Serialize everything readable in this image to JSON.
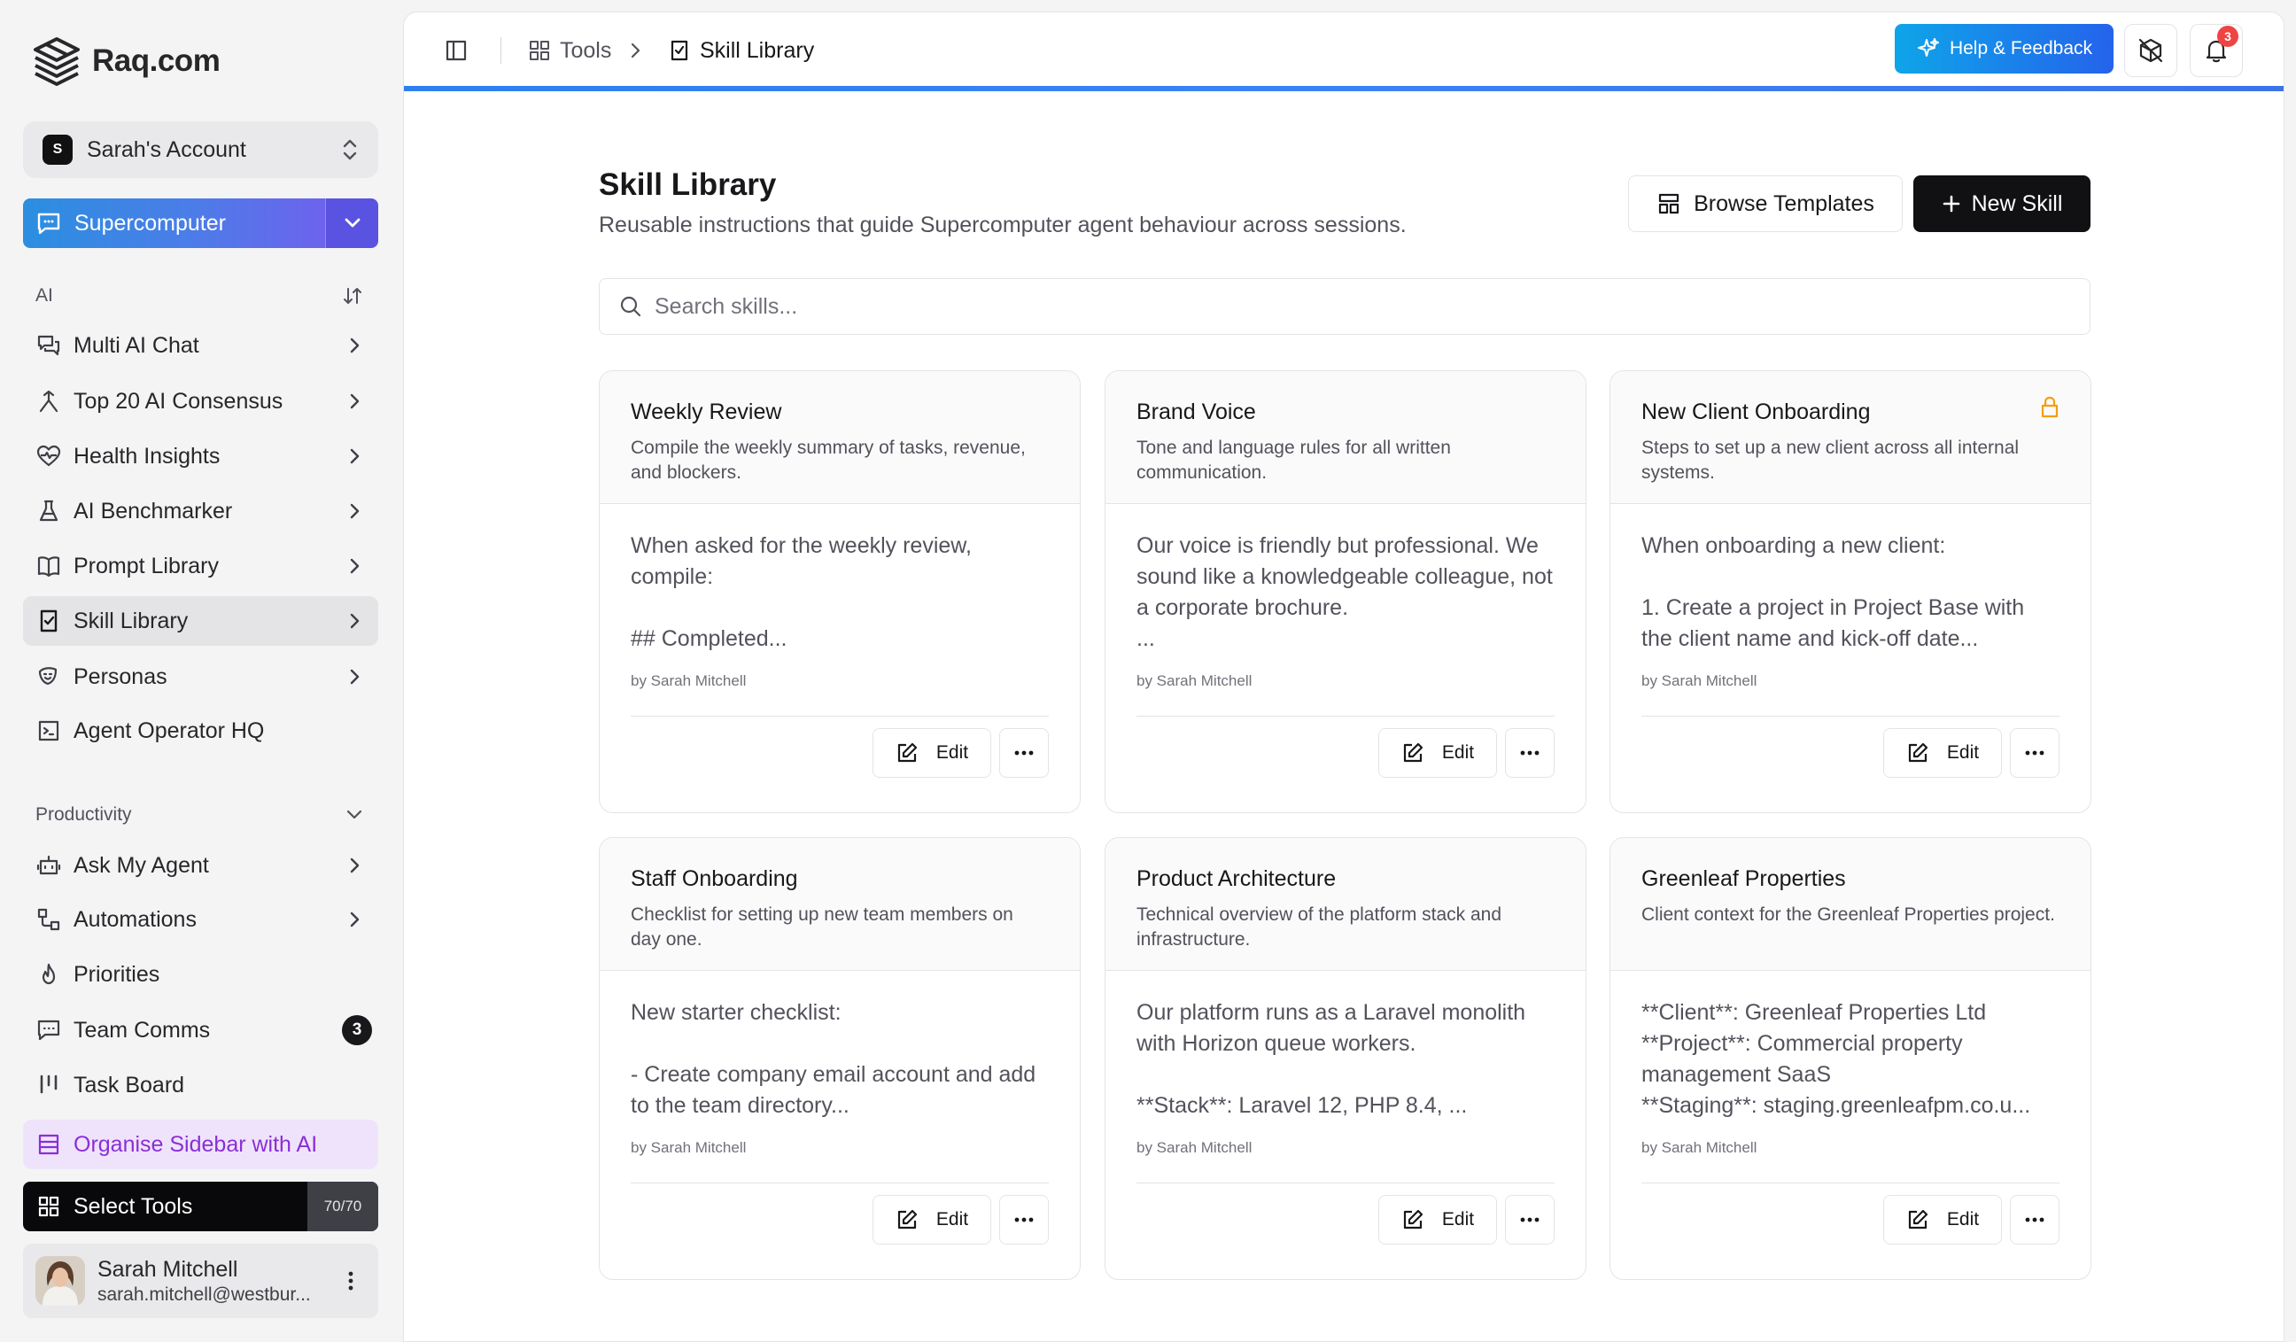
{
  "brand": {
    "name": "Raq.com"
  },
  "account": {
    "badge": "S",
    "name": "Sarah's Account"
  },
  "supercomputer": {
    "label": "Supercomputer"
  },
  "sections": {
    "ai": "AI",
    "productivity": "Productivity"
  },
  "ai_items": [
    {
      "label": "Multi AI Chat",
      "icon": "chat-icon"
    },
    {
      "label": "Top 20 AI Consensus",
      "icon": "consensus-icon"
    },
    {
      "label": "Health Insights",
      "icon": "heart-pulse-icon"
    },
    {
      "label": "AI Benchmarker",
      "icon": "flask-icon"
    },
    {
      "label": "Prompt Library",
      "icon": "book-icon"
    },
    {
      "label": "Skill Library",
      "icon": "skill-icon"
    },
    {
      "label": "Personas",
      "icon": "persona-icon"
    },
    {
      "label": "Agent Operator HQ",
      "icon": "terminal-icon"
    }
  ],
  "productivity_items": [
    {
      "label": "Ask My Agent",
      "icon": "bot-icon"
    },
    {
      "label": "Automations",
      "icon": "workflow-icon"
    },
    {
      "label": "Priorities",
      "icon": "flame-icon"
    },
    {
      "label": "Team Comms",
      "icon": "message-icon",
      "count": "3"
    },
    {
      "label": "Task Board",
      "icon": "kanban-icon"
    }
  ],
  "organise": {
    "label": "Organise Sidebar with AI"
  },
  "select_tools": {
    "label": "Select Tools",
    "count": "70/70"
  },
  "user": {
    "name": "Sarah Mitchell",
    "email": "sarah.mitchell@westbur..."
  },
  "breadcrumb": {
    "tools": "Tools",
    "current": "Skill Library"
  },
  "header": {
    "help": "Help & Feedback",
    "notifications": "3"
  },
  "page": {
    "title": "Skill Library",
    "subtitle": "Reusable instructions that guide Supercomputer agent behaviour across sessions.",
    "browse": "Browse Templates",
    "new": "New Skill",
    "search_placeholder": "Search skills..."
  },
  "cards": [
    {
      "title": "Weekly Review",
      "desc": "Compile the weekly summary of tasks, revenue, and blockers.",
      "content": "When asked for the weekly review, compile:\n\n## Completed...",
      "author": "by Sarah Mitchell",
      "edit": "Edit",
      "locked": false
    },
    {
      "title": "Brand Voice",
      "desc": "Tone and language rules for all written communication.",
      "content": "Our voice is friendly but professional. We sound like a knowledgeable colleague, not a corporate brochure.\n...",
      "author": "by Sarah Mitchell",
      "edit": "Edit",
      "locked": false
    },
    {
      "title": "New Client Onboarding",
      "desc": "Steps to set up a new client across all internal systems.",
      "content": "When onboarding a new client:\n\n1. Create a project in Project Base with the client name and kick-off date...",
      "author": "by Sarah Mitchell",
      "edit": "Edit",
      "locked": true
    },
    {
      "title": "Staff Onboarding",
      "desc": "Checklist for setting up new team members on day one.",
      "content": "New starter checklist:\n\n- Create company email account and add to the team directory...",
      "author": "by Sarah Mitchell",
      "edit": "Edit",
      "locked": false
    },
    {
      "title": "Product Architecture",
      "desc": "Technical overview of the platform stack and infrastructure.",
      "content": "Our platform runs as a Laravel monolith with Horizon queue workers.\n\n**Stack**: Laravel 12, PHP 8.4, ...",
      "author": "by Sarah Mitchell",
      "edit": "Edit",
      "locked": false
    },
    {
      "title": "Greenleaf Properties",
      "desc": "Client context for the Greenleaf Properties project.",
      "content": "**Client**: Greenleaf Properties Ltd\n**Project**: Commercial property management SaaS\n**Staging**: staging.greenleafpm.co.u...",
      "author": "by Sarah Mitchell",
      "edit": "Edit",
      "locked": false
    }
  ],
  "colors": {
    "accent": "#2563eb",
    "organise": "#8a2fd6",
    "lock": "#f59e0b",
    "badge": "#ef4444"
  }
}
